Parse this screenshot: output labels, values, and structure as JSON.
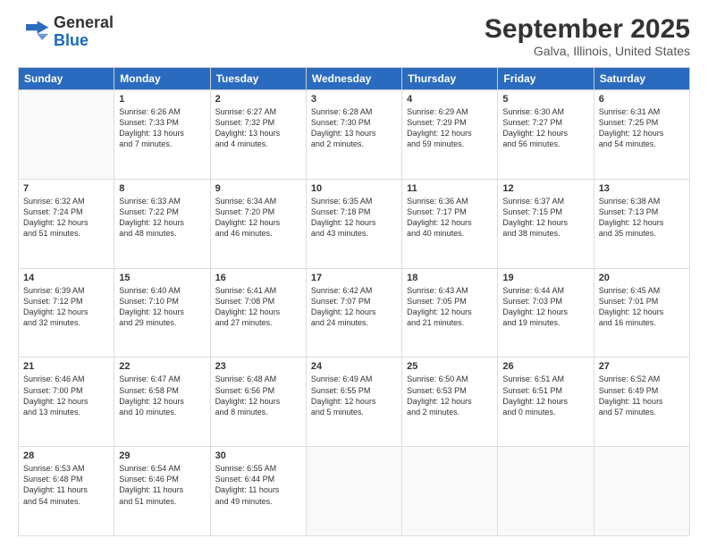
{
  "logo": {
    "line1": "General",
    "line2": "Blue"
  },
  "title": "September 2025",
  "location": "Galva, Illinois, United States",
  "days_of_week": [
    "Sunday",
    "Monday",
    "Tuesday",
    "Wednesday",
    "Thursday",
    "Friday",
    "Saturday"
  ],
  "weeks": [
    [
      {
        "num": "",
        "info": ""
      },
      {
        "num": "1",
        "info": "Sunrise: 6:26 AM\nSunset: 7:33 PM\nDaylight: 13 hours\nand 7 minutes."
      },
      {
        "num": "2",
        "info": "Sunrise: 6:27 AM\nSunset: 7:32 PM\nDaylight: 13 hours\nand 4 minutes."
      },
      {
        "num": "3",
        "info": "Sunrise: 6:28 AM\nSunset: 7:30 PM\nDaylight: 13 hours\nand 2 minutes."
      },
      {
        "num": "4",
        "info": "Sunrise: 6:29 AM\nSunset: 7:29 PM\nDaylight: 12 hours\nand 59 minutes."
      },
      {
        "num": "5",
        "info": "Sunrise: 6:30 AM\nSunset: 7:27 PM\nDaylight: 12 hours\nand 56 minutes."
      },
      {
        "num": "6",
        "info": "Sunrise: 6:31 AM\nSunset: 7:25 PM\nDaylight: 12 hours\nand 54 minutes."
      }
    ],
    [
      {
        "num": "7",
        "info": "Sunrise: 6:32 AM\nSunset: 7:24 PM\nDaylight: 12 hours\nand 51 minutes."
      },
      {
        "num": "8",
        "info": "Sunrise: 6:33 AM\nSunset: 7:22 PM\nDaylight: 12 hours\nand 48 minutes."
      },
      {
        "num": "9",
        "info": "Sunrise: 6:34 AM\nSunset: 7:20 PM\nDaylight: 12 hours\nand 46 minutes."
      },
      {
        "num": "10",
        "info": "Sunrise: 6:35 AM\nSunset: 7:18 PM\nDaylight: 12 hours\nand 43 minutes."
      },
      {
        "num": "11",
        "info": "Sunrise: 6:36 AM\nSunset: 7:17 PM\nDaylight: 12 hours\nand 40 minutes."
      },
      {
        "num": "12",
        "info": "Sunrise: 6:37 AM\nSunset: 7:15 PM\nDaylight: 12 hours\nand 38 minutes."
      },
      {
        "num": "13",
        "info": "Sunrise: 6:38 AM\nSunset: 7:13 PM\nDaylight: 12 hours\nand 35 minutes."
      }
    ],
    [
      {
        "num": "14",
        "info": "Sunrise: 6:39 AM\nSunset: 7:12 PM\nDaylight: 12 hours\nand 32 minutes."
      },
      {
        "num": "15",
        "info": "Sunrise: 6:40 AM\nSunset: 7:10 PM\nDaylight: 12 hours\nand 29 minutes."
      },
      {
        "num": "16",
        "info": "Sunrise: 6:41 AM\nSunset: 7:08 PM\nDaylight: 12 hours\nand 27 minutes."
      },
      {
        "num": "17",
        "info": "Sunrise: 6:42 AM\nSunset: 7:07 PM\nDaylight: 12 hours\nand 24 minutes."
      },
      {
        "num": "18",
        "info": "Sunrise: 6:43 AM\nSunset: 7:05 PM\nDaylight: 12 hours\nand 21 minutes."
      },
      {
        "num": "19",
        "info": "Sunrise: 6:44 AM\nSunset: 7:03 PM\nDaylight: 12 hours\nand 19 minutes."
      },
      {
        "num": "20",
        "info": "Sunrise: 6:45 AM\nSunset: 7:01 PM\nDaylight: 12 hours\nand 16 minutes."
      }
    ],
    [
      {
        "num": "21",
        "info": "Sunrise: 6:46 AM\nSunset: 7:00 PM\nDaylight: 12 hours\nand 13 minutes."
      },
      {
        "num": "22",
        "info": "Sunrise: 6:47 AM\nSunset: 6:58 PM\nDaylight: 12 hours\nand 10 minutes."
      },
      {
        "num": "23",
        "info": "Sunrise: 6:48 AM\nSunset: 6:56 PM\nDaylight: 12 hours\nand 8 minutes."
      },
      {
        "num": "24",
        "info": "Sunrise: 6:49 AM\nSunset: 6:55 PM\nDaylight: 12 hours\nand 5 minutes."
      },
      {
        "num": "25",
        "info": "Sunrise: 6:50 AM\nSunset: 6:53 PM\nDaylight: 12 hours\nand 2 minutes."
      },
      {
        "num": "26",
        "info": "Sunrise: 6:51 AM\nSunset: 6:51 PM\nDaylight: 12 hours\nand 0 minutes."
      },
      {
        "num": "27",
        "info": "Sunrise: 6:52 AM\nSunset: 6:49 PM\nDaylight: 11 hours\nand 57 minutes."
      }
    ],
    [
      {
        "num": "28",
        "info": "Sunrise: 6:53 AM\nSunset: 6:48 PM\nDaylight: 11 hours\nand 54 minutes."
      },
      {
        "num": "29",
        "info": "Sunrise: 6:54 AM\nSunset: 6:46 PM\nDaylight: 11 hours\nand 51 minutes."
      },
      {
        "num": "30",
        "info": "Sunrise: 6:55 AM\nSunset: 6:44 PM\nDaylight: 11 hours\nand 49 minutes."
      },
      {
        "num": "",
        "info": ""
      },
      {
        "num": "",
        "info": ""
      },
      {
        "num": "",
        "info": ""
      },
      {
        "num": "",
        "info": ""
      }
    ]
  ]
}
